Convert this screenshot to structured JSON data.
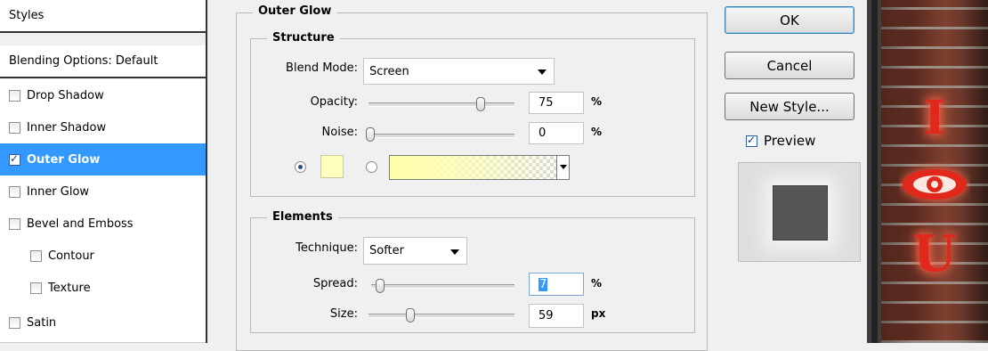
{
  "styles_list": {
    "header": "Styles",
    "blending": "Blending Options: Default",
    "items": [
      {
        "label": "Drop Shadow",
        "checked": false
      },
      {
        "label": "Inner Shadow",
        "checked": false
      },
      {
        "label": "Outer Glow",
        "checked": true,
        "selected": true
      },
      {
        "label": "Inner Glow",
        "checked": false
      },
      {
        "label": "Bevel and Emboss",
        "checked": false
      },
      {
        "label": "Contour",
        "checked": false,
        "indented": true
      },
      {
        "label": "Texture",
        "checked": false,
        "indented": true
      },
      {
        "label": "Satin",
        "checked": false
      }
    ]
  },
  "panel": {
    "title": "Outer Glow",
    "structure": {
      "title": "Structure",
      "blend_mode_label": "Blend Mode:",
      "blend_mode_value": "Screen",
      "opacity_label": "Opacity:",
      "opacity_value": "75",
      "opacity_unit": "%",
      "noise_label": "Noise:",
      "noise_value": "0",
      "noise_unit": "%",
      "glow_color": "#ffffbe",
      "gradient_from": "#ffffa8"
    },
    "elements": {
      "title": "Elements",
      "technique_label": "Technique:",
      "technique_value": "Softer",
      "spread_label": "Spread:",
      "spread_value": "7",
      "spread_unit": "%",
      "size_label": "Size:",
      "size_value": "59",
      "size_unit": "px"
    }
  },
  "buttons": {
    "ok": "OK",
    "cancel": "Cancel",
    "new_style": "New Style...",
    "preview_label": "Preview",
    "preview_checked": true
  },
  "poster": {
    "letter_top": "I",
    "letter_bottom": "U",
    "glow_color": "#e0281c"
  }
}
